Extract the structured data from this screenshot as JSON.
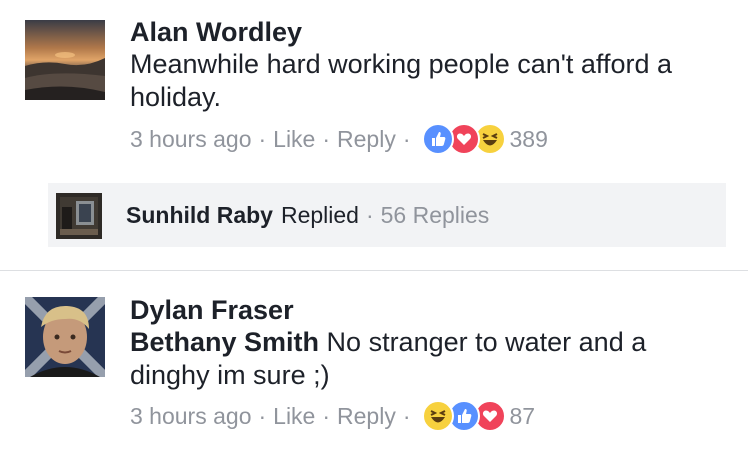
{
  "comments": [
    {
      "author": "Alan Wordley",
      "mention": "",
      "text": "Meanwhile hard working people can't afford a holiday.",
      "time": "3 hours ago",
      "like_label": "Like",
      "reply_label": "Reply",
      "reactions": [
        "like",
        "love",
        "haha"
      ],
      "reaction_count": "389"
    },
    {
      "author": "Dylan Fraser",
      "mention": "Bethany Smith",
      "text": "No stranger to water and a dinghy im sure ;)",
      "time": "3 hours ago",
      "like_label": "Like",
      "reply_label": "Reply",
      "reactions": [
        "haha",
        "like",
        "love"
      ],
      "reaction_count": "87"
    }
  ],
  "replies_summary": {
    "name": "Sunhild Raby",
    "action": "Replied",
    "count": "56 Replies"
  },
  "separator": "·",
  "colors": {
    "like": "#5890ff",
    "love": "#f0435a",
    "haha": "#f7d13e",
    "meta": "#90949c",
    "text": "#1d2129"
  }
}
